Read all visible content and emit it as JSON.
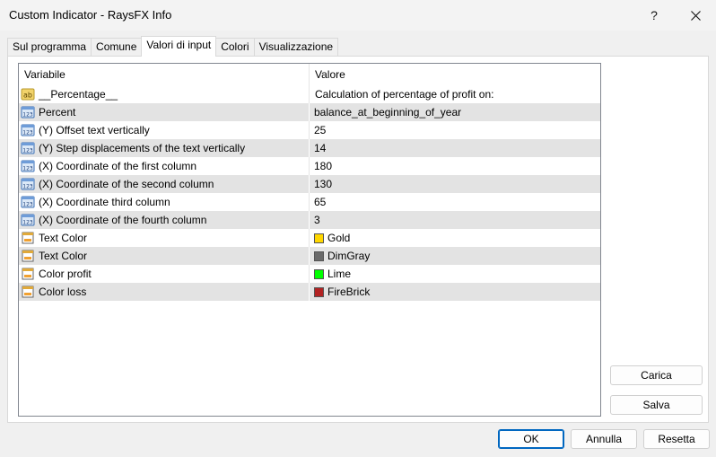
{
  "window": {
    "title": "Custom Indicator - RaysFX Info",
    "help_label": "?"
  },
  "tabs": [
    {
      "label": "Sul programma",
      "active": false
    },
    {
      "label": "Comune",
      "active": false
    },
    {
      "label": "Valori di input",
      "active": true
    },
    {
      "label": "Colori",
      "active": false
    },
    {
      "label": "Visualizzazione",
      "active": false
    }
  ],
  "grid": {
    "columns": [
      "Variabile",
      "Valore"
    ],
    "rows": [
      {
        "icon": "string-ab-icon",
        "variable": "__Percentage__",
        "value": "Calculation of percentage of profit on:"
      },
      {
        "icon": "number-123-icon",
        "variable": "Percent",
        "value": "balance_at_beginning_of_year"
      },
      {
        "icon": "number-123-icon",
        "variable": "(Y) Offset text vertically",
        "value": "25"
      },
      {
        "icon": "number-123-icon",
        "variable": "(Y) Step displacements of the text vertically",
        "value": "14"
      },
      {
        "icon": "number-123-icon",
        "variable": "(X) Coordinate of the first column",
        "value": "180"
      },
      {
        "icon": "number-123-icon",
        "variable": "(X) Coordinate of the second column",
        "value": "130"
      },
      {
        "icon": "number-123-icon",
        "variable": "(X) Coordinate third column",
        "value": "65"
      },
      {
        "icon": "number-123-icon",
        "variable": "(X) Coordinate of the fourth column",
        "value": "3"
      },
      {
        "icon": "color-icon",
        "variable": "Text Color",
        "value": "Gold",
        "swatch": "#ffd700"
      },
      {
        "icon": "color-icon",
        "variable": "Text Color",
        "value": "DimGray",
        "swatch": "#696969"
      },
      {
        "icon": "color-icon",
        "variable": "Color profit",
        "value": "Lime",
        "swatch": "#00ff00"
      },
      {
        "icon": "color-icon",
        "variable": "Color loss",
        "value": "FireBrick",
        "swatch": "#b22222"
      }
    ]
  },
  "side_buttons": {
    "load": "Carica",
    "save": "Salva"
  },
  "footer": {
    "ok": "OK",
    "cancel": "Annulla",
    "reset": "Resetta"
  },
  "colors": {
    "accent": "#0067c0",
    "alt_row": "#e3e3e3"
  }
}
